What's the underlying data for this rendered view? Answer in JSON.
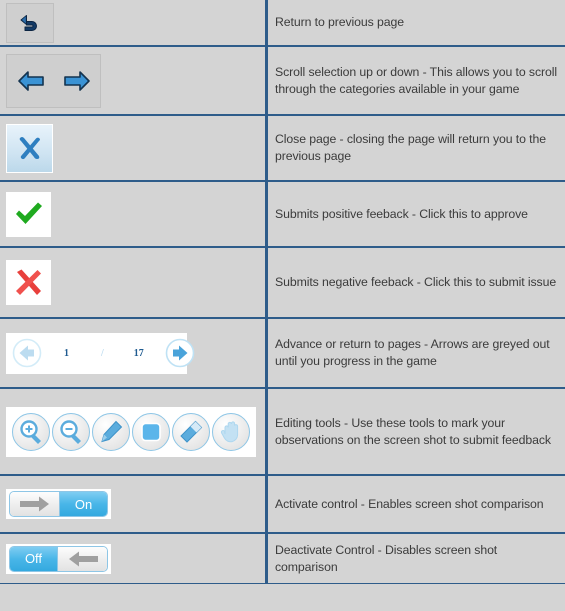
{
  "legend": {
    "rows": [
      {
        "icon_name": "back-arrow-icon",
        "description": "Return to previous page"
      },
      {
        "icon_name": "scroll-left-right-arrows-icon",
        "description": "Scroll selection up or down - This allows you to scroll through the categories available in your game"
      },
      {
        "icon_name": "close-page-x-icon",
        "description": "Close page - closing the page will return you to the previous page"
      },
      {
        "icon_name": "green-check-icon",
        "description": "Submits positive feeback - Click this to approve"
      },
      {
        "icon_name": "red-x-icon",
        "description": "Submits negative feeback - Click this to submit issue"
      },
      {
        "icon_name": "pagination-control",
        "description": "Advance or return to pages - Arrows are greyed out until you progress in the game"
      },
      {
        "icon_name": "editing-toolbar",
        "description": "Editing tools - Use these tools to mark your observations on the screen shot to submit feedback"
      },
      {
        "icon_name": "toggle-on",
        "description": "Activate control - Enables screen shot comparison"
      },
      {
        "icon_name": "toggle-off",
        "description": "Deactivate Control - Disables screen shot comparison"
      }
    ]
  },
  "pagination": {
    "current_page": "1",
    "separator": "/",
    "total_pages": "17",
    "prev_label": "previous-page-arrow",
    "next_label": "next-page-arrow"
  },
  "tools": [
    {
      "name": "zoom-in-icon"
    },
    {
      "name": "zoom-out-icon"
    },
    {
      "name": "pen-icon"
    },
    {
      "name": "rectangle-icon"
    },
    {
      "name": "eraser-icon"
    },
    {
      "name": "hand-pan-icon"
    }
  ],
  "toggles": {
    "on_label": "On",
    "off_label": "Off"
  },
  "colors": {
    "border": "#2e5c8a",
    "cell_bg": "#d4d4d4",
    "text": "#3b3b3b",
    "accent_blue": "#3b93d4",
    "toggle_blue": "#49b6e8",
    "check_green": "#1faa1f",
    "x_red": "#e8403c",
    "pager_blue": "#1f5b90",
    "pager_pale": "#bcdcf0"
  }
}
